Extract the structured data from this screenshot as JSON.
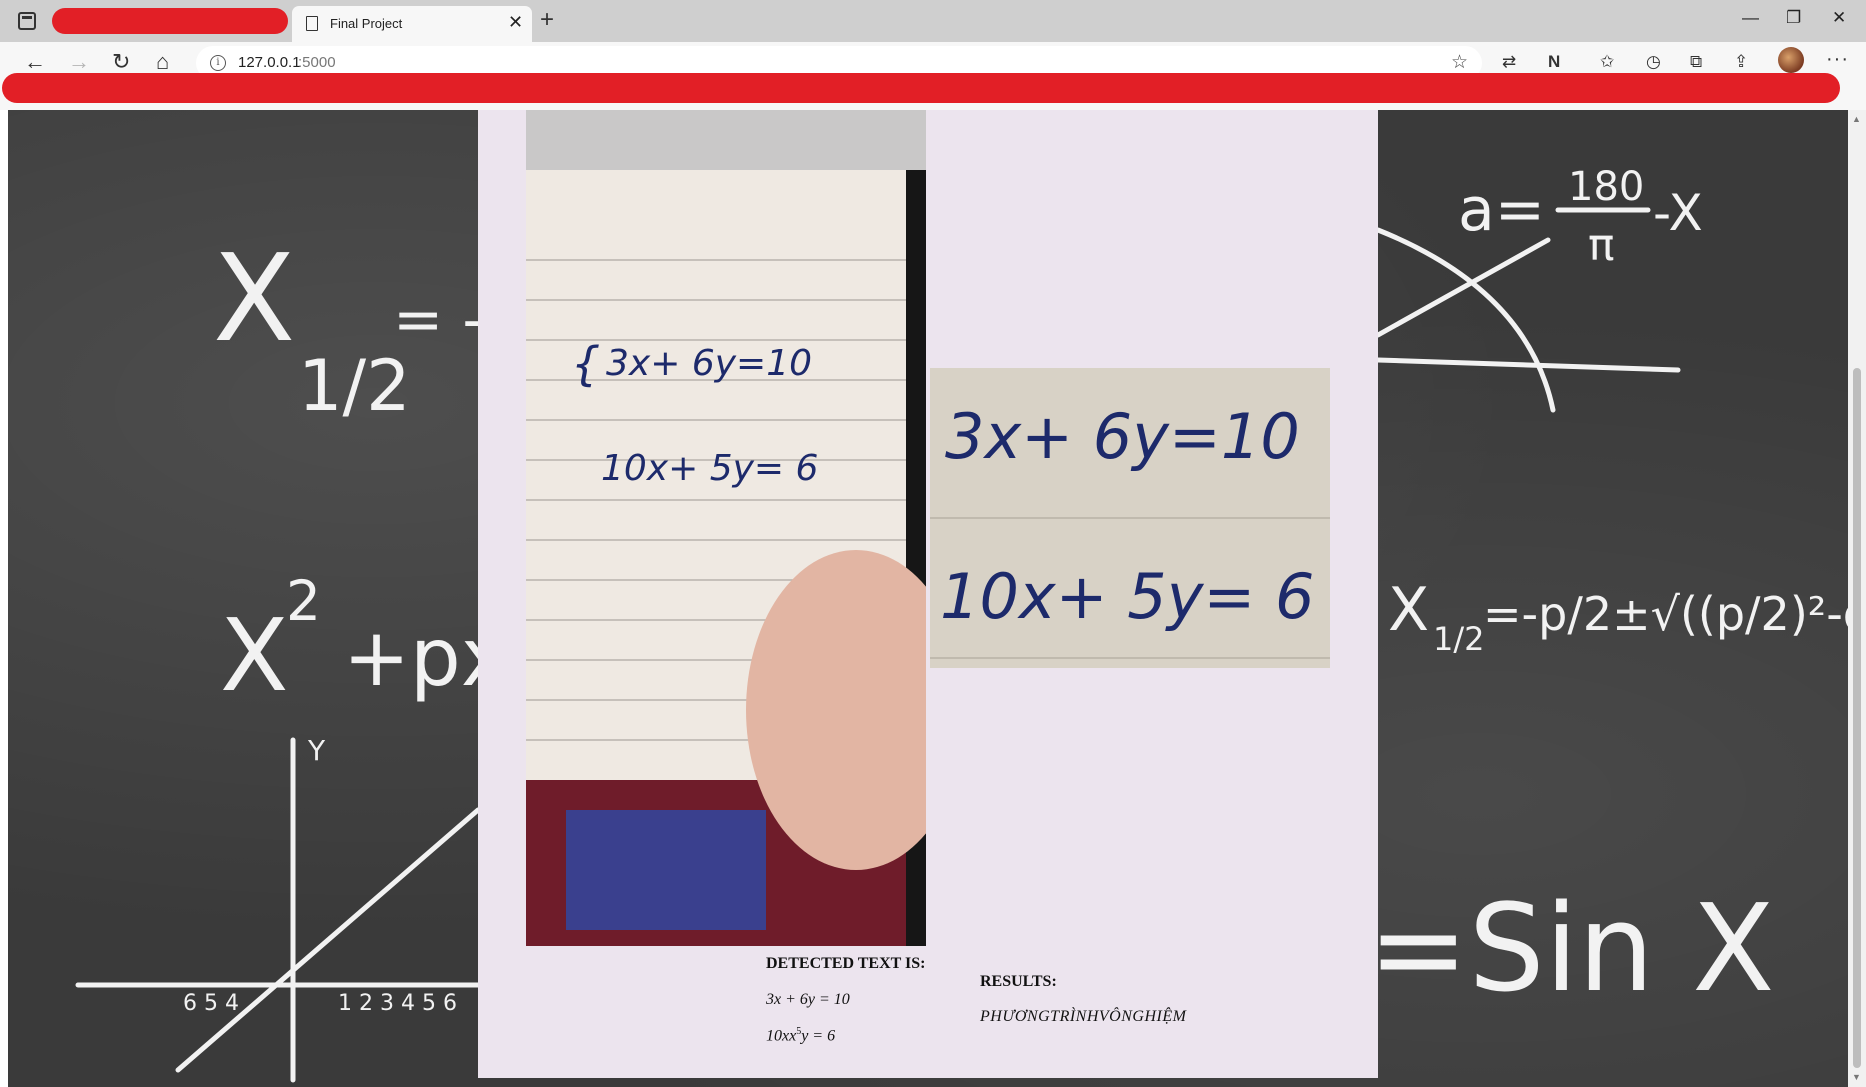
{
  "browser": {
    "tab": {
      "title": "Final Project",
      "close": "✕"
    },
    "new_tab": "+",
    "window": {
      "minimize": "—",
      "restore": "❐",
      "close": "✕"
    },
    "nav": {
      "back": "←",
      "forward": "→",
      "reload": "↻",
      "home": "⌂"
    },
    "address": {
      "host": "127.0.0.1",
      "port": ":5000",
      "info": "i"
    },
    "toolbar_icons": [
      "translate-icon",
      "notion-icon",
      "favorites-icon",
      "history-icon",
      "collections-icon",
      "share-icon"
    ],
    "menu": "···"
  },
  "page": {
    "detected_heading": "DETECTED TEXT IS:",
    "equations": [
      {
        "text": "3x + 6y = 10"
      },
      {
        "text": "10xx",
        "sup": "5",
        "tail": "y = 6"
      }
    ],
    "results_heading": "RESULTS:",
    "results_text": "PHƯƠNGTRÌNHVÔNGHIỆM"
  },
  "colors": {
    "redaction": "#e21f26",
    "panel": "#ece4ee",
    "chalkboard": "#3a3a3a",
    "ink": "#1d2a6b"
  }
}
